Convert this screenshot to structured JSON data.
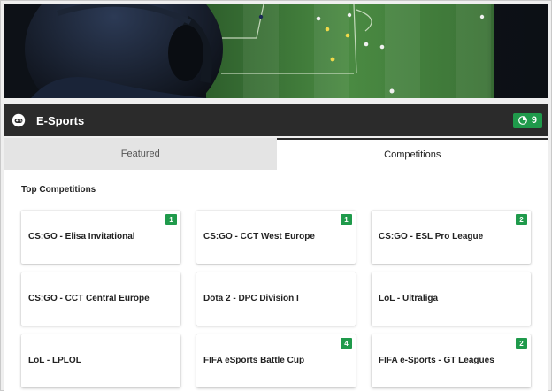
{
  "header": {
    "title": "E-Sports",
    "live_count": "9",
    "icon": "controller-icon",
    "live_icon": "clock-live-icon"
  },
  "tabs": [
    {
      "label": "Featured",
      "active": false
    },
    {
      "label": "Competitions",
      "active": true
    }
  ],
  "section": {
    "title": "Top Competitions"
  },
  "competitions": [
    {
      "name": "CS:GO - Elisa Invitational",
      "count": "1"
    },
    {
      "name": "CS:GO - CCT West Europe",
      "count": "1"
    },
    {
      "name": "CS:GO - ESL Pro League",
      "count": "2"
    },
    {
      "name": "CS:GO - CCT Central Europe",
      "count": ""
    },
    {
      "name": "Dota 2 - DPC Division I",
      "count": ""
    },
    {
      "name": "LoL - Ultraliga",
      "count": ""
    },
    {
      "name": "LoL - LPLOL",
      "count": ""
    },
    {
      "name": "FIFA eSports Battle Cup",
      "count": "4"
    },
    {
      "name": "FIFA e-Sports - GT Leagues",
      "count": "2"
    }
  ],
  "colors": {
    "header_bg": "#2b2b2b",
    "accent_green": "#1f9a4b",
    "pitch_green": "#3f7f3a"
  }
}
